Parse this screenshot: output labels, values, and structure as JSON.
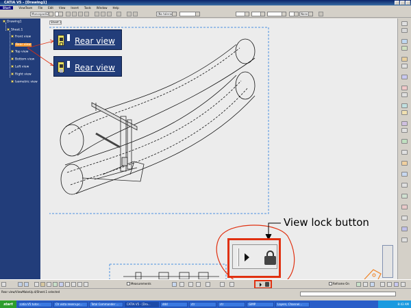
{
  "window": {
    "title": "CATIA V5 - [Drawing1]"
  },
  "menu": {
    "start_label": "Start",
    "items": [
      "ViewTeam",
      "File",
      "Edit",
      "View",
      "Insert",
      "Tools",
      "Window",
      "Help"
    ]
  },
  "toolbar": {
    "font_combo": "Monospac821",
    "tolerance_combo": "(No tolerance)",
    "format_combo": "None"
  },
  "tree": {
    "items": [
      {
        "label": "Drawing1"
      },
      {
        "label": "Sheet.1"
      },
      {
        "label": "Front view"
      },
      {
        "label": "Rear view"
      },
      {
        "label": "Top view"
      },
      {
        "label": "Bottom view"
      },
      {
        "label": "Left view"
      },
      {
        "label": "Right view"
      },
      {
        "label": "Isometric view"
      }
    ],
    "selected_index": 3
  },
  "sheet_tab": "Sheet.1",
  "callouts": [
    {
      "label": "Rear view"
    },
    {
      "label": "Rear view"
    }
  ],
  "annotation": {
    "label": "View lock button"
  },
  "bottom_toolbar": {
    "measure_label": "Measurements",
    "reframe_label": "Reframe On"
  },
  "statusbar": {
    "message": "Rear view/ViewMakeUp.4/Sheet.1 selected"
  },
  "taskbar": {
    "start_label": "start",
    "tasks": [
      "catia V5 tutor...",
      "Ch vista reserv.pc...",
      "Total Commander ...",
      "CATIA V5 - [Dra...",
      "ddd",
      "ctr",
      "ctr",
      "GIMP",
      "Layers, Channel..."
    ],
    "active_index": 3,
    "clock": "8:43 AM"
  },
  "colors": {
    "tree_bg": "#223d7a",
    "selected": "#ff9a30",
    "annotation_red": "#e03010"
  }
}
